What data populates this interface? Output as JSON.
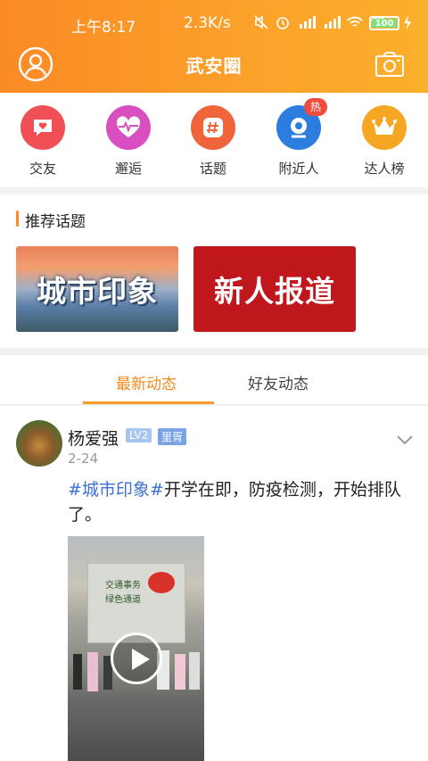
{
  "status_bar": {
    "time": "上午8:17",
    "network_speed": "2.3K/s",
    "battery": "100",
    "icons": [
      "mute-icon",
      "alarm-icon",
      "signal-hd-icon",
      "signal-hd-icon",
      "wifi-icon",
      "wifi-icon",
      "battery-icon",
      "charging-icon"
    ]
  },
  "header": {
    "title": "武安圈",
    "left_icon": "profile-icon",
    "right_icon": "camera-icon",
    "gradient": [
      "#fb8a26",
      "#fbb02c"
    ]
  },
  "quick_menu": [
    {
      "label": "交友",
      "icon": "heart-chat-icon",
      "color": "#f04f55"
    },
    {
      "label": "邂逅",
      "icon": "heartbeat-icon",
      "color": "#d94fc0"
    },
    {
      "label": "话题",
      "icon": "hashtag-icon",
      "color": "#f0643c"
    },
    {
      "label": "附近人",
      "icon": "location-person-icon",
      "color": "#2d7de0",
      "badge": "热"
    },
    {
      "label": "达人榜",
      "icon": "crown-icon",
      "color": "#f5a623"
    }
  ],
  "recommended": {
    "title": "推荐话题",
    "cards": [
      {
        "label": "城市印象"
      },
      {
        "label": "新人报道"
      }
    ]
  },
  "tabs": {
    "latest": "最新动态",
    "friends": "好友动态",
    "active": "latest"
  },
  "post": {
    "author": "杨爱强",
    "level": "LV2",
    "badge": "里胥",
    "date": "2-24",
    "hashtag": "#城市印象#",
    "text": "开学在即，防疫检测，开始排队了。",
    "video_sign": [
      "交通事务",
      "绿色通道"
    ]
  },
  "accent": "#f08a1d"
}
